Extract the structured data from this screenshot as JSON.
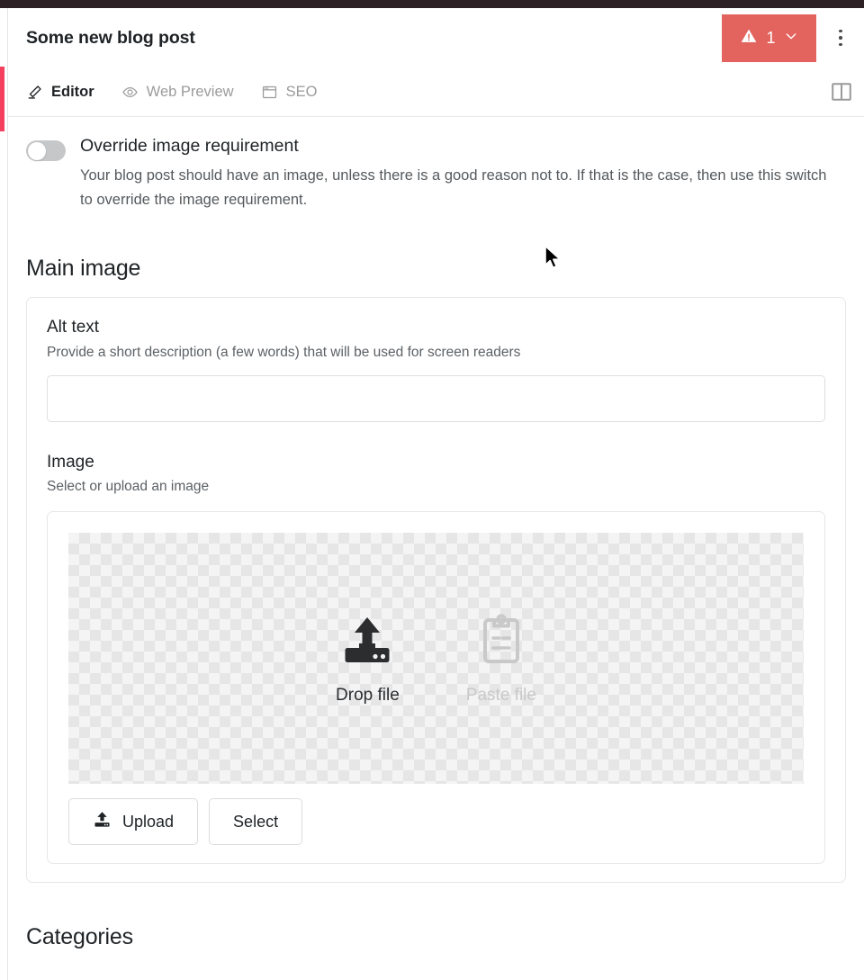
{
  "window": {
    "accent_color": "#f43f5e",
    "top_strip_color": "#2c2024"
  },
  "header": {
    "title": "Some new blog post",
    "validation": {
      "count": "1",
      "icon": "warning-triangle-icon",
      "chevron": "chevron-down-icon",
      "color": "#e3635e"
    },
    "menu_icon": "kebab-menu-icon"
  },
  "tabs": [
    {
      "label": "Editor",
      "icon": "pencil-icon",
      "active": true
    },
    {
      "label": "Web Preview",
      "icon": "eye-icon",
      "active": false
    },
    {
      "label": "SEO",
      "icon": "browser-window-icon",
      "active": false
    }
  ],
  "panel_toggle": {
    "icon": "split-panel-icon"
  },
  "override_switch": {
    "title": "Override image requirement",
    "description": "Your blog post should have an image, unless there is a good reason not to. If that is the case, then use this switch to override the image requirement.",
    "state": "off"
  },
  "main_image": {
    "heading": "Main image",
    "alt_text": {
      "label": "Alt text",
      "description": "Provide a short description (a few words) that will be used for screen readers",
      "value": "",
      "placeholder": ""
    },
    "image": {
      "label": "Image",
      "description": "Select or upload an image",
      "dropzone": {
        "drop": {
          "label": "Drop file",
          "icon": "upload-drive-icon",
          "enabled": true
        },
        "paste": {
          "label": "Paste file",
          "icon": "clipboard-icon",
          "enabled": false
        }
      },
      "buttons": [
        {
          "label": "Upload",
          "icon": "upload-icon"
        },
        {
          "label": "Select",
          "icon": null
        }
      ]
    }
  },
  "categories": {
    "heading": "Categories"
  }
}
